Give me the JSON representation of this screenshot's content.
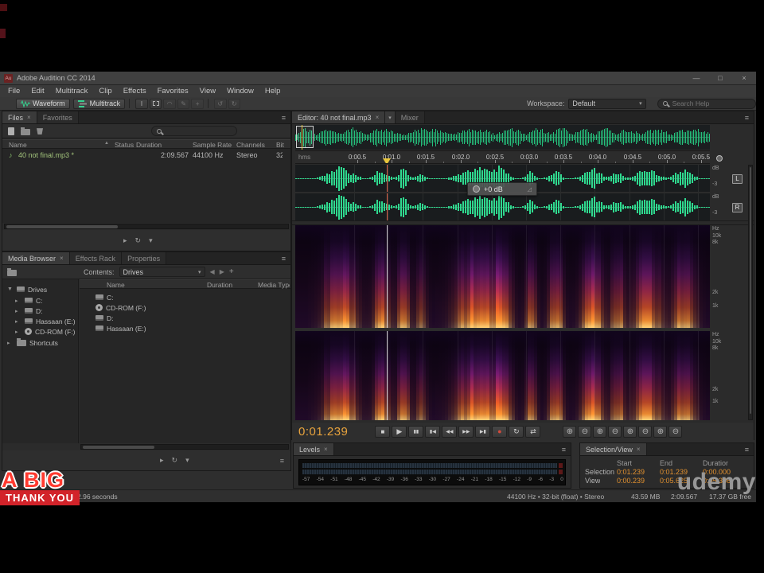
{
  "credits": {
    "line1": "A BIG",
    "line2": "THANK YOU",
    "brand": "udemy"
  },
  "titlebar": {
    "title": "Adobe Audition CC 2014",
    "app_badge": "Au",
    "minimize": "—",
    "maximize": "□",
    "close": "×"
  },
  "menus": [
    "File",
    "Edit",
    "Multitrack",
    "Clip",
    "Effects",
    "Favorites",
    "View",
    "Window",
    "Help"
  ],
  "toolbar": {
    "waveform": "Waveform",
    "multitrack": "Multitrack",
    "workspace_label": "Workspace:",
    "workspace": "Default",
    "search_placeholder": "Search Help"
  },
  "ui": {
    "caret": "▾",
    "sort_asc": "▲",
    "back": "◀",
    "forward": "▶",
    "plus": "+",
    "menu": "≡",
    "twisty_open": "▼",
    "twisty_closed": "▸",
    "note": "♪",
    "play_small": "▸",
    "loop_small": "↻"
  },
  "files": {
    "tab": "Files",
    "tab_favorites": "Favorites",
    "columns": {
      "name": "Name",
      "status": "Status",
      "duration": "Duration",
      "sample_rate": "Sample Rate",
      "channels": "Channels",
      "bit_depth": "Bit Depth"
    },
    "row": {
      "name": "40 not final.mp3 *",
      "status": "",
      "duration": "2:09.567",
      "sample_rate": "44100 Hz",
      "channels": "Stereo",
      "bit_depth": "32"
    }
  },
  "browser": {
    "tab": "Media Browser",
    "tab_effects": "Effects Rack",
    "tab_properties": "Properties",
    "contents_label": "Contents:",
    "contents_value": "Drives",
    "tree_root": "Drives",
    "tree_items": [
      "C:",
      "D:",
      "Hassaan (E:)",
      "CD-ROM (F:)"
    ],
    "tree_root2": "Shortcuts",
    "columns": {
      "name": "Name",
      "duration": "Duration",
      "media_type": "Media Type"
    },
    "rows": [
      "C:",
      "CD-ROM (F:)",
      "D:",
      "Hassaan (E:)"
    ]
  },
  "editor": {
    "tab": "Editor: 40 not final.mp3",
    "tab_mixer": "Mixer",
    "ruler_unit": "hms",
    "ruler": [
      "0:00.5",
      "0:01.0",
      "0:01.5",
      "0:02.0",
      "0:02.5",
      "0:03.0",
      "0:03.5",
      "0:04.0",
      "0:04.5",
      "0:05.0",
      "0:05.5"
    ],
    "hud_value": "+0 dB",
    "db_unit": "dB",
    "db_tick": "-3",
    "freq": [
      "Hz",
      "10k",
      "8k",
      "2k",
      "1k"
    ],
    "left_channel": "L",
    "right_channel": "R",
    "time_display": "0:01.239",
    "transport": {
      "stop": "■",
      "play": "▶",
      "pause": "▮▮",
      "prev": "▮◀",
      "rewind": "◀◀",
      "forward": "▶▶",
      "next": "▶▮",
      "record": "●",
      "loop": "↻",
      "swap": "⇄"
    },
    "zoom_in": "⊕",
    "zoom_out": "⊖"
  },
  "levels": {
    "tab": "Levels",
    "scale": [
      "-57",
      "-54",
      "-51",
      "-48",
      "-45",
      "-42",
      "-39",
      "-36",
      "-33",
      "-30",
      "-27",
      "-24",
      "-21",
      "-18",
      "-15",
      "-12",
      "-9",
      "-6",
      "-3",
      "0"
    ]
  },
  "selection": {
    "tab": "Selection/View",
    "col_start": "Start",
    "col_end": "End",
    "col_duration": "Duration",
    "row1_label": "Selection",
    "row2_label": "View",
    "row1": {
      "start": "0:01.239",
      "end": "0:01.239",
      "duration": "0:00.000"
    },
    "row2": {
      "start": "0:00.239",
      "end": "0:05.625",
      "duration": "0:05.386"
    }
  },
  "status": {
    "message": "2.96 seconds",
    "format": "44100 Hz • 32-bit (float) • Stereo",
    "file_size": "43.59 MB",
    "file_duration": "2:09.567",
    "free_space": "17.37 GB free"
  }
}
